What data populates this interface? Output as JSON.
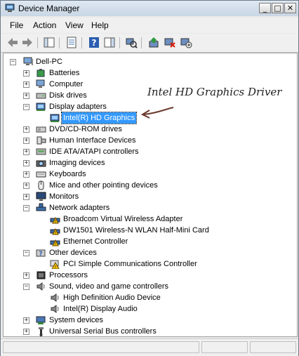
{
  "window": {
    "title": "Device Manager",
    "controls": {
      "minimize": "_",
      "maximize": "□",
      "close": "✕"
    }
  },
  "menu": [
    "File",
    "Action",
    "View",
    "Help"
  ],
  "toolbar_icons": [
    "back-icon",
    "forward-icon",
    "console-tree-icon",
    "properties-icon",
    "help-icon",
    "action-pane-icon",
    "scan-hardware-icon",
    "update-driver-icon",
    "uninstall-icon",
    "disable-icon"
  ],
  "tree": {
    "root": "Dell-PC",
    "items": [
      {
        "label": "Batteries",
        "expander": "+",
        "icon": "battery-icon"
      },
      {
        "label": "Computer",
        "expander": "+",
        "icon": "computer-icon"
      },
      {
        "label": "Disk drives",
        "expander": "+",
        "icon": "disk-drive-icon"
      },
      {
        "label": "Display adapters",
        "expander": "−",
        "icon": "display-adapter-icon"
      },
      {
        "label": "Intel(R) HD Graphics",
        "child": true,
        "selected": true,
        "icon": "display-adapter-icon"
      },
      {
        "label": "DVD/CD-ROM drives",
        "expander": "+",
        "icon": "dvd-drive-icon"
      },
      {
        "label": "Human Interface Devices",
        "expander": "+",
        "icon": "hid-icon"
      },
      {
        "label": "IDE ATA/ATAPI controllers",
        "expander": "+",
        "icon": "ide-controller-icon"
      },
      {
        "label": "Imaging devices",
        "expander": "+",
        "icon": "camera-icon"
      },
      {
        "label": "Keyboards",
        "expander": "+",
        "icon": "keyboard-icon"
      },
      {
        "label": "Mice and other pointing devices",
        "expander": "+",
        "icon": "mouse-icon"
      },
      {
        "label": "Monitors",
        "expander": "+",
        "icon": "monitor-icon"
      },
      {
        "label": "Network adapters",
        "expander": "−",
        "icon": "network-adapter-icon"
      },
      {
        "label": "Broadcom Virtual Wireless Adapter",
        "child": true,
        "icon": "network-warning-icon"
      },
      {
        "label": "DW1501 Wireless-N WLAN Half-Mini Card",
        "child": true,
        "icon": "network-warning-icon"
      },
      {
        "label": "Ethernet Controller",
        "child": true,
        "icon": "network-warning-icon"
      },
      {
        "label": "Other devices",
        "expander": "−",
        "icon": "unknown-device-icon"
      },
      {
        "label": "PCI Simple Communications Controller",
        "child": true,
        "icon": "unknown-device-warning-icon"
      },
      {
        "label": "Processors",
        "expander": "+",
        "icon": "processor-icon"
      },
      {
        "label": "Sound, video and game controllers",
        "expander": "−",
        "icon": "speaker-icon"
      },
      {
        "label": "High Definition Audio Device",
        "child": true,
        "icon": "speaker-icon"
      },
      {
        "label": "Intel(R) Display Audio",
        "child": true,
        "icon": "speaker-icon"
      },
      {
        "label": "System devices",
        "expander": "+",
        "icon": "system-device-icon"
      },
      {
        "label": "Universal Serial Bus controllers",
        "expander": "+",
        "icon": "usb-icon"
      }
    ]
  },
  "annotation": "Intel HD Graphics Driver",
  "colors": {
    "selection": "#3399ff",
    "warning": "#f2c200",
    "annotation_arrow": "#6b3a2e"
  }
}
